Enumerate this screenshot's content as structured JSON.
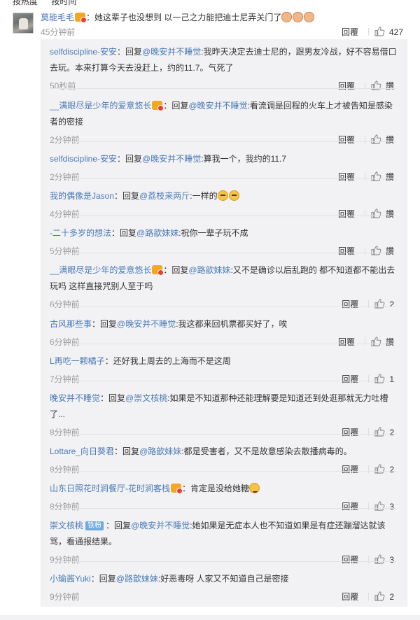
{
  "topbar": {
    "items": [
      "按热度",
      "按时间"
    ]
  },
  "main_comment": {
    "user": "莫能毛毛",
    "text": "：她这辈子也没想到 以一己之力能把迪士尼弄关门了",
    "time": "45分钟前",
    "reply_label": "回覆",
    "likes": "427"
  },
  "replies": [
    {
      "user": "selfdiscipline-安安",
      "badge": false,
      "prefix": "：回复",
      "mention": "@晚安并不睡觉",
      "text": ":我昨天决定去迪士尼的，跟男友冷战，好不容易借口去玩。本来打算今天去没赶上，约的11.7。气死了",
      "time": "50秒前",
      "reply_label": "回覆",
      "likes": "讚"
    },
    {
      "user": "__满眼尽是少年的爱意悠长",
      "badge": true,
      "prefix": "：回复",
      "mention": "@晚安并不睡觉",
      "text": ":看流调是回程的火车上才被告知是感染者的密接",
      "time": "2分钟前",
      "reply_label": "回覆",
      "likes": "讚"
    },
    {
      "user": "selfdiscipline-安安",
      "badge": false,
      "prefix": "：回复",
      "mention": "@晚安并不睡觉",
      "text": ":算我一个，我约的11.7",
      "time": "2分钟前",
      "reply_label": "回覆",
      "likes": "讚"
    },
    {
      "user": "我的偶像是Jason",
      "badge": false,
      "prefix": "：回复",
      "mention": "@荔枝来两斤",
      "text": ":一样的",
      "time": "4分钟前",
      "reply_label": "回覆",
      "likes": "讚"
    },
    {
      "user": "-二十多岁的想法",
      "badge": false,
      "prefix": "：回复",
      "mention": "@路歆妹妹",
      "text": ":祝你一辈子玩不成",
      "time": "5分钟前",
      "reply_label": "回覆",
      "likes": "讚"
    },
    {
      "user": "__满眼尽是少年的爱意悠长",
      "badge": true,
      "prefix": "：回复",
      "mention": "@路歆妹妹",
      "text": ":又不是确诊以后乱跑的 都不知道都不能出去玩吗 这样直接咒别人至于吗",
      "time": "6分钟前",
      "reply_label": "回覆",
      "likes": "2"
    },
    {
      "user": "古风那些事",
      "badge": false,
      "prefix": "：回复",
      "mention": "@晚安并不睡觉",
      "text": ":我这都来回机票都买好了，唉",
      "time": "6分钟前",
      "reply_label": "回覆",
      "likes": "讚"
    },
    {
      "user": "L再吃一颗橘子",
      "badge": false,
      "prefix": "",
      "mention": "",
      "text": "：还好我上周去的上海而不是这周",
      "time": "7分钟前",
      "reply_label": "回覆",
      "likes": "1"
    },
    {
      "user": "晚安并不睡觉",
      "badge": false,
      "prefix": "：回复",
      "mention": "@崇文核桃",
      "text": ":如果是不知道那种还能理解要是知道还到处逛那就无力吐槽了...",
      "time": "8分钟前",
      "reply_label": "回覆",
      "likes": "2"
    },
    {
      "user": "Lottare_向日葵君",
      "badge": false,
      "prefix": "：回复",
      "mention": "@路歆妹妹",
      "text": ":都是受害者，又不是故意感染去散播病毒的。",
      "time": "8分钟前",
      "reply_label": "回覆",
      "likes": "2"
    },
    {
      "user": "山东日照花时涧餐厅-花时涧客栈",
      "badge": true,
      "prefix": "",
      "mention": "",
      "text": "：肯定是没给她糖",
      "time": "8分钟前",
      "reply_label": "回覆",
      "likes": "3"
    },
    {
      "user": "崇文核桃",
      "badge": false,
      "tag": "铁粉",
      "prefix": "：回复",
      "mention": "@晚安并不睡觉",
      "text": ":她如果是无症本人也不知道如果是有症还蹦溜达就该骂，看通报结果。",
      "time": "9分钟前",
      "reply_label": "回覆",
      "likes": "3"
    },
    {
      "user": "小瑜酱Yuki",
      "badge": false,
      "prefix": "：回复",
      "mention": "@路歆妹妹",
      "text": ":好恶毒呀 人家又不知道自己是密接",
      "time": "9分钟前",
      "reply_label": "回覆",
      "likes": "2"
    }
  ]
}
